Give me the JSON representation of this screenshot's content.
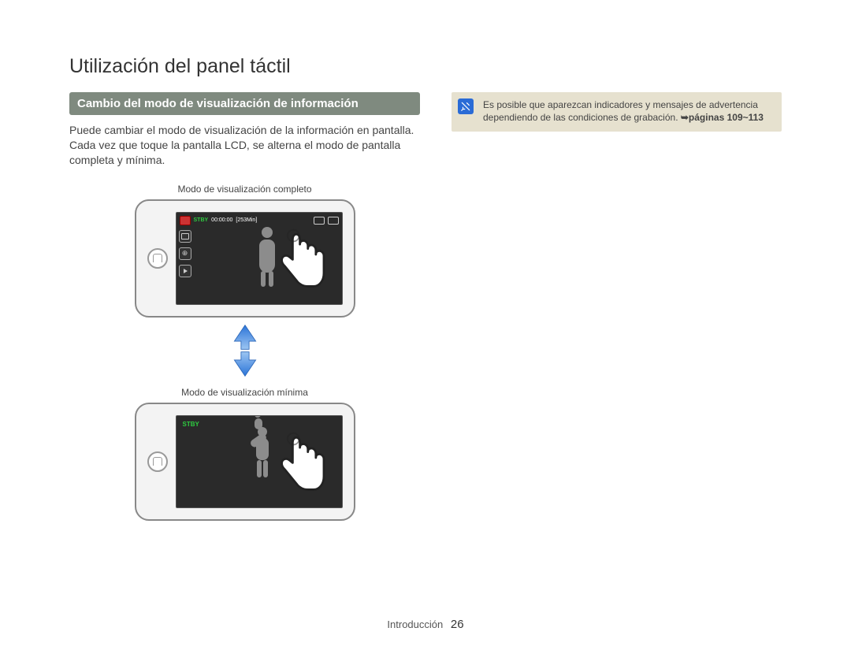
{
  "title": "Utilización del panel táctil",
  "subheading": "Cambio del modo de visualización de información",
  "body": "Puede cambiar el modo de visualización de la información en pantalla. Cada vez que toque la pantalla LCD, se alterna el modo de pantalla completa y mínima.",
  "caption_full": "Modo de visualización completo",
  "caption_min": "Modo de visualización mínima",
  "osd": {
    "stby": "STBY",
    "time": "00:00:00",
    "remain": "[253Min]"
  },
  "note": {
    "text_a": "Es posible que aparezcan indicadores y mensajes de advertencia dependiendo de las condiciones de grabación. ",
    "pageref": "➥páginas 109~113"
  },
  "footer": {
    "section": "Introducción",
    "page": "26"
  }
}
